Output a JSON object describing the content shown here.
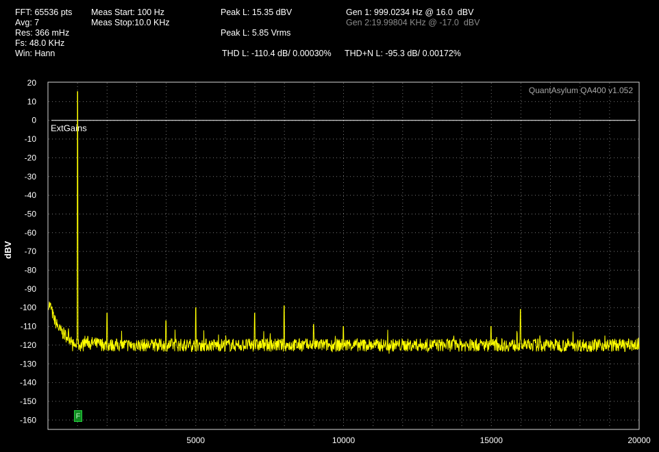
{
  "header": {
    "fft": "FFT: 65536 pts",
    "avg": "Avg: 7",
    "res": "Res: 366 mHz",
    "fs": "Fs: 48.0 KHz",
    "win": "Win: Hann",
    "meas_start": "Meas Start: 100 Hz",
    "meas_stop": "Meas Stop:10.0 KHz",
    "peak_dbv": "Peak L: 15.35 dBV",
    "peak_vrms": "Peak L: 5.85 Vrms",
    "gen1": "Gen 1: 999.0234 Hz @ 16.0  dBV",
    "gen2": "Gen 2:19.99804 KHz @ -17.0  dBV",
    "thd": "THD L: -110.4 dB/ 0.00030%",
    "thdn": "THD+N L: -95.3 dB/ 0.00172%"
  },
  "chart_data": {
    "type": "line",
    "title": "",
    "xlabel": "",
    "ylabel": "dBV",
    "xlim": [
      0,
      20000
    ],
    "ylim": [
      -165,
      20
    ],
    "x_ticks": [
      5000,
      10000,
      15000,
      20000
    ],
    "y_ticks": [
      20,
      10,
      0,
      -10,
      -20,
      -30,
      -40,
      -50,
      -60,
      -70,
      -80,
      -90,
      -100,
      -110,
      -120,
      -130,
      -140,
      -150,
      -160
    ],
    "grid": true,
    "watermark": "QuantAsylum QA400 v1.052",
    "reference_line": {
      "label": "ExtGains",
      "y": 0
    },
    "marker_label": "F",
    "noise_floor_dbv": -120,
    "series": [
      {
        "color": "#ffff00",
        "points": [
          {
            "x": 0,
            "y": -97
          },
          {
            "x": 100,
            "y": -100
          },
          {
            "x": 200,
            "y": -106
          },
          {
            "x": 400,
            "y": -112
          },
          {
            "x": 600,
            "y": -115
          },
          {
            "x": 800,
            "y": -117
          },
          {
            "x": 999,
            "y": 15.35
          },
          {
            "x": 1200,
            "y": -118
          },
          {
            "x": 1500,
            "y": -119
          },
          {
            "x": 2000,
            "y": -120
          },
          {
            "x": 20000,
            "y": -120
          }
        ],
        "spikes": [
          {
            "x": 1999,
            "y": -103
          },
          {
            "x": 3996,
            "y": -107
          },
          {
            "x": 4995,
            "y": -100
          },
          {
            "x": 6993,
            "y": -103
          },
          {
            "x": 7992,
            "y": -99
          },
          {
            "x": 8991,
            "y": -109
          },
          {
            "x": 9990,
            "y": -110
          },
          {
            "x": 14985,
            "y": -110
          },
          {
            "x": 15984,
            "y": -101
          }
        ]
      }
    ],
    "colors": {
      "trace": "#ffff00",
      "grid": "#7a7a7a",
      "frame": "#d8d8d8",
      "marker": "#0f8a20"
    }
  }
}
